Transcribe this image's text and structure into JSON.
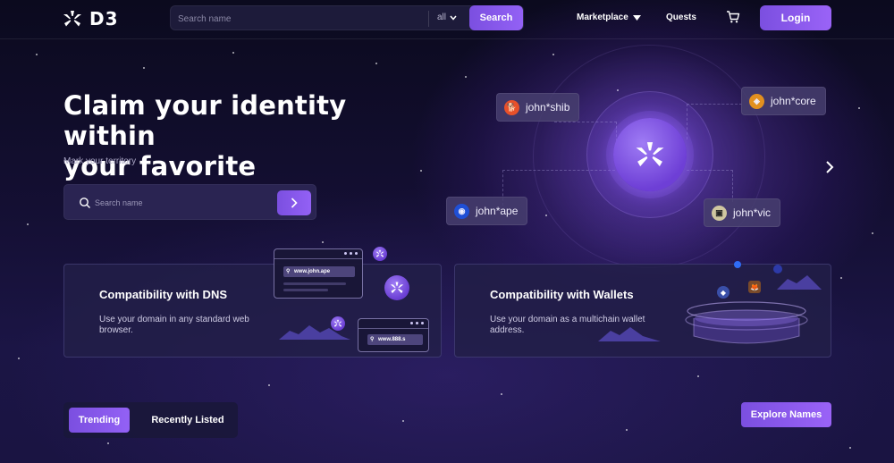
{
  "header": {
    "logo_text": "D3",
    "search": {
      "placeholder": "Search name",
      "filter_value": "all",
      "button_label": "Search"
    },
    "nav": {
      "marketplace": "Marketplace",
      "quests": "Quests"
    },
    "login_label": "Login"
  },
  "hero": {
    "title_line1": "Claim your identity within",
    "title_line2": "your favorite communities",
    "subtitle": "Mark your territory",
    "search_placeholder": "Search name"
  },
  "orbit": {
    "names": [
      {
        "label": "john*shib",
        "icon": "shib-token-icon",
        "color": "#e8502a"
      },
      {
        "label": "john*core",
        "icon": "core-token-icon",
        "color": "#e2901f"
      },
      {
        "label": "john*ape",
        "icon": "ape-token-icon",
        "color": "#1f4fd6"
      },
      {
        "label": "john*vic",
        "icon": "vic-token-icon",
        "color": "#cfc6a0"
      }
    ]
  },
  "features": {
    "dns": {
      "title": "Compatibility with DNS",
      "description": "Use your domain in any standard web browser.",
      "url_1": "www.john.ape",
      "url_2": "www.888.s"
    },
    "wallet": {
      "title": "Compatibility with Wallets",
      "description": "Use your domain as a multichain wallet address."
    }
  },
  "listing": {
    "tabs": [
      "Trending",
      "Recently Listed"
    ],
    "active_tab": "Trending",
    "explore_label": "Explore Names"
  },
  "colors": {
    "accent": "#8657ee",
    "background": "#120f2c",
    "card": "#221e48"
  }
}
